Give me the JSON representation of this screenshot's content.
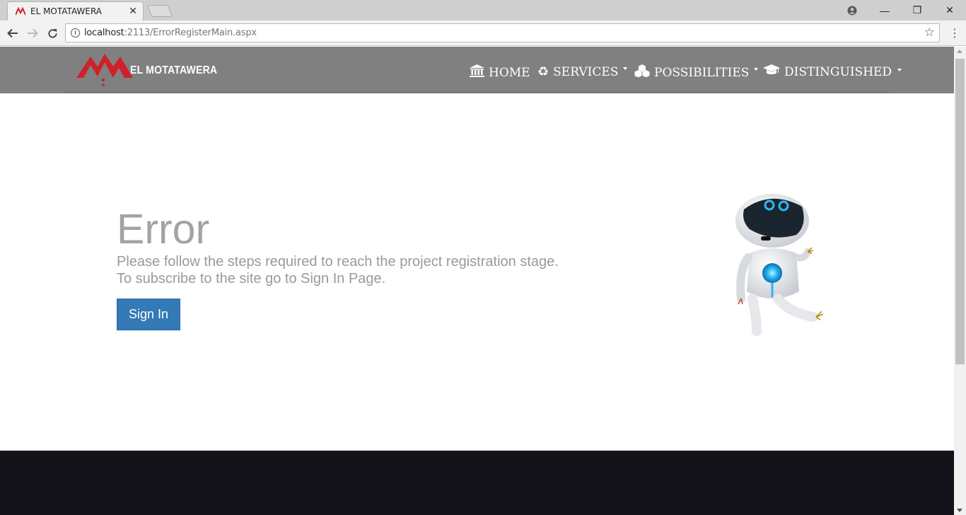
{
  "browser": {
    "tab_title": "EL MOTATAWERA",
    "tab_close": "✕",
    "url_host": "localhost",
    "url_rest": ":2113/ErrorRegisterMain.aspx",
    "window_controls": {
      "minimize": "—",
      "restore": "❐",
      "close": "✕"
    }
  },
  "site": {
    "brand": "EL MOTATAWERA",
    "logo_color": "#d0202a",
    "nav": [
      {
        "label": "HOME",
        "icon": "bank-icon",
        "glyph": "🏛"
      },
      {
        "label": "SERVICES",
        "icon": "recycle-icon",
        "glyph": "♻"
      },
      {
        "label": "POSSIBILITIES",
        "icon": "cubes-icon",
        "glyph": "⬢"
      },
      {
        "label": "DISTINGUISHED",
        "icon": "graduation-cap-icon",
        "glyph": "🎓"
      }
    ]
  },
  "main": {
    "title": "Error",
    "line1": "Please follow the steps required to reach the project registration stage.",
    "line2": "To subscribe to the site go to Sign In Page.",
    "button": "Sign In",
    "button_color": "#337ab7"
  },
  "colors": {
    "navbar": "#808080",
    "footer": "#141319"
  }
}
